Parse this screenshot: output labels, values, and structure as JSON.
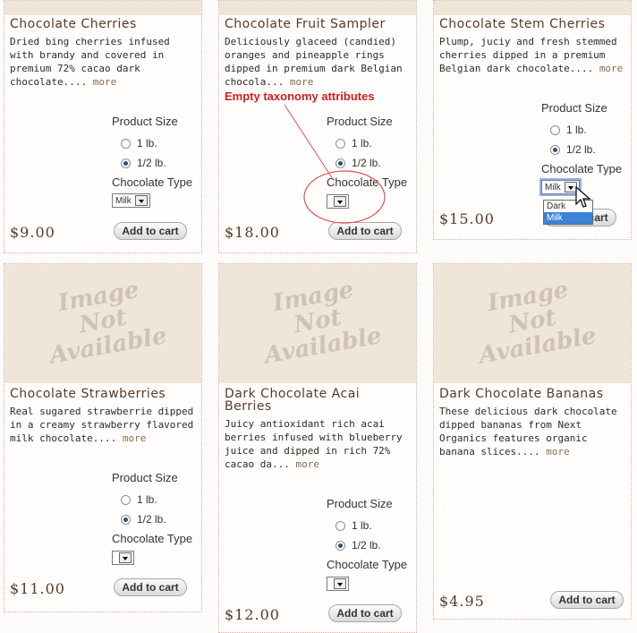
{
  "products": [
    {
      "title": "Chocolate Cherries",
      "desc": "Dried bing cherries infused with brandy and covered in premium 72% cacao dark chocolate....",
      "more": "more",
      "size_label": "Product Size",
      "opt1": "1 lb.",
      "opt2": "1/2 lb.",
      "type_label": "Chocolate Type",
      "type_value": "Milk",
      "price": "$9.00",
      "cart": "Add to cart"
    },
    {
      "title": "Chocolate Fruit Sampler",
      "desc": "Deliciously glaceed (candied) oranges and pineapple rings dipped in premium dark Belgian chocola...",
      "more": "more",
      "size_label": "Product Size",
      "opt1": "1 lb.",
      "opt2": "1/2 lb.",
      "type_label": "Chocolate Type",
      "type_value": "",
      "price": "$18.00",
      "cart": "Add to cart"
    },
    {
      "title": "Chocolate Stem Cherries",
      "desc": "Plump, juciy and fresh stemmed cherries dipped in a premium Belgian dark chocolate....",
      "more": "more",
      "size_label": "Product Size",
      "opt1": "1 lb.",
      "opt2": "1/2 lb.",
      "type_label": "Chocolate Type",
      "type_value": "Milk",
      "price": "$15.00",
      "cart": "Add to cart",
      "dropdown": [
        "Dark",
        "Milk"
      ]
    },
    {
      "title": "Chocolate Strawberries",
      "desc": "Real sugared strawberrie dipped in a creamy strawberry flavored milk chocolate....",
      "more": "more",
      "size_label": "Product Size",
      "opt1": "1 lb.",
      "opt2": "1/2 lb.",
      "type_label": "Chocolate Type",
      "type_value": "",
      "price": "$11.00",
      "cart": "Add to cart",
      "image_text": "Image Not Available"
    },
    {
      "title": "Dark Chocolate Acai Berries",
      "desc": "Juicy antioxidant rich acai berries infused with blueberry juice and dipped in rich 72% cacao da...",
      "more": "more",
      "size_label": "Product Size",
      "opt1": "1 lb.",
      "opt2": "1/2 lb.",
      "type_label": "Chocolate Type",
      "type_value": "",
      "price": "$12.00",
      "cart": "Add to cart",
      "image_text": "Image Not Available"
    },
    {
      "title": "Dark Chocolate Bananas",
      "desc": "These delicious dark chocolate dipped bananas from Next Organics features organic banana slices....",
      "more": "more",
      "price": "$4.95",
      "cart": "Add to cart",
      "image_text": "Image Not Available"
    }
  ],
  "annotation": "Empty taxonomy attributes",
  "colors": {
    "accent": "#d11f1f",
    "title": "#5a3a24",
    "image_bg": "#efe6d9"
  }
}
